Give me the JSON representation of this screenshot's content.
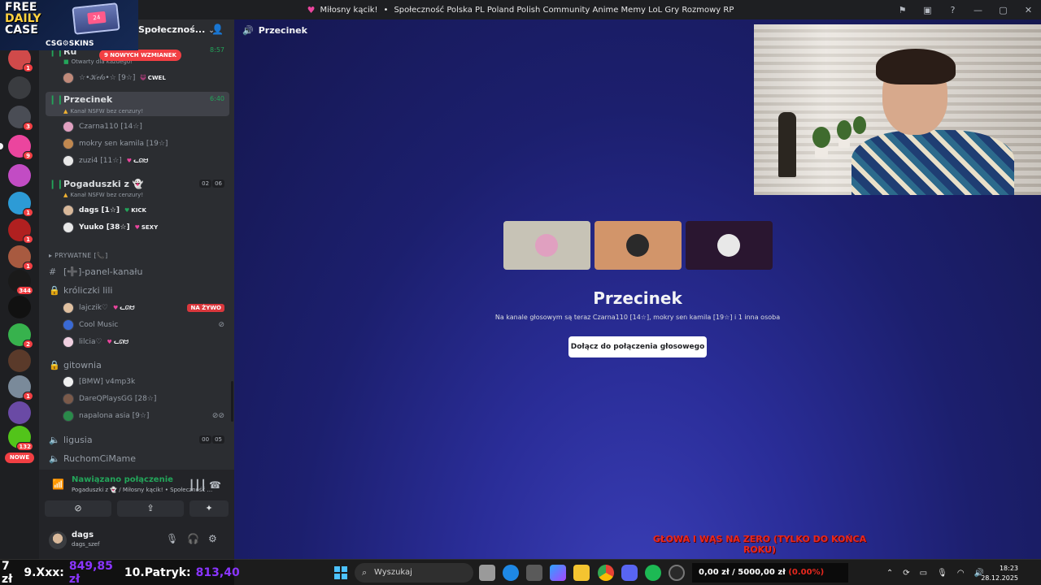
{
  "titlebar": {
    "server_name": "Miłosny kącik!",
    "separator": "•",
    "description": "Społeczność Polska PL Poland Polish Community Anime Memy LoL Gry Rozmowy RP"
  },
  "promo": {
    "line1": "FREE",
    "line2": "DAILY",
    "line3": "CASE",
    "case_label": "24",
    "brand": "CSG⚙SKINS"
  },
  "rail": {
    "servers": [
      {
        "name": "server-1",
        "badge": "1",
        "color": "#d04a4a"
      },
      {
        "name": "server-2",
        "badge": "",
        "color": "#3a3c40"
      },
      {
        "name": "server-3",
        "badge": "3",
        "color": "#4a4d55"
      },
      {
        "name": "server-4",
        "badge": "9",
        "color": "#eb459e"
      },
      {
        "name": "server-5",
        "badge": "",
        "color": "#c24cc4"
      },
      {
        "name": "server-6",
        "badge": "1",
        "color": "#2d9bd6"
      },
      {
        "name": "server-7",
        "badge": "1",
        "color": "#b02020"
      },
      {
        "name": "server-8",
        "badge": "1",
        "color": "#a85a40"
      },
      {
        "name": "server-9",
        "badge": "344",
        "color": "#1a1a1a"
      },
      {
        "name": "server-10",
        "badge": "",
        "color": "#111111"
      },
      {
        "name": "server-11",
        "badge": "2",
        "color": "#37b24d"
      },
      {
        "name": "server-12",
        "badge": "",
        "color": "#5a3a2a"
      },
      {
        "name": "server-13",
        "badge": "1",
        "color": "#7a8a9a"
      },
      {
        "name": "server-14",
        "badge": "",
        "color": "#6a4aa5"
      },
      {
        "name": "server-15",
        "badge": "132",
        "color": "#52c41a"
      }
    ],
    "new_label": "NOWE"
  },
  "sidebar": {
    "server_header": "Społecznoś...",
    "mentions_pill": "9 NOWYCH WZMIANEK",
    "top_channel": {
      "name": "Ru",
      "time": "8:57",
      "sub": "Otwarty dla każdego!"
    },
    "top_member": {
      "name": "☆•𝒦𝑒𝓁𝑜•☆ [9☆]",
      "tag": "CWEL"
    },
    "active_channel": {
      "name": "Przecinek",
      "time": "6:40",
      "sub": "Kanał NSFW bez cenzury!"
    },
    "active_members": [
      {
        "name": "Czarna110 [14☆]",
        "tag": "",
        "color": "#e0a0c0"
      },
      {
        "name": "mokry sen kamila [19☆]",
        "tag": "",
        "color": "#c08850"
      },
      {
        "name": "zuzi4 [11☆]",
        "tag": "ᓚᘏᗢ",
        "color": "#e8e8e8"
      }
    ],
    "channel_pogaduszki": {
      "name": "Pogaduszki z 👻",
      "sub": "Kanał NSFW bez cenzury!",
      "ctr_a": "02",
      "ctr_b": "06"
    },
    "pogaduszki_members": [
      {
        "name": "dags [1☆]",
        "tag": "KICK",
        "color": "#d8b89a"
      },
      {
        "name": "Yuuko [38☆]",
        "tag": "SEXY",
        "color": "#e8e8e8"
      }
    ],
    "category_private": "PRYWATNE [📞]",
    "channel_panel": "[➕]-panel-kanału",
    "channel_kroliczki": "króliczki lili",
    "kroliczki_members": [
      {
        "name": "lajczik♡",
        "tag": "ᓚᘏᗢ",
        "live": "NA ŻYWO",
        "color": "#e0c0a0"
      },
      {
        "name": "Cool Music",
        "tag": "",
        "live": "",
        "color": "#3a6ad4"
      },
      {
        "name": "lilcia♡",
        "tag": "ᓚᘏᗢ",
        "live": "",
        "color": "#f0d0e0"
      }
    ],
    "channel_gitownia": "gitownia",
    "gitownia_members": [
      {
        "name": "[BMW] v4mp3k",
        "tag": "",
        "color": "#f0f0f0"
      },
      {
        "name": "DareQPlaysGG [28☆]",
        "tag": "",
        "color": "#7a5a4a"
      },
      {
        "name": "napalona asia [9☆]",
        "tag": "",
        "color": "#2a8a4a"
      }
    ],
    "channel_ligusia": {
      "name": "ligusia",
      "ctr_a": "00",
      "ctr_b": "05"
    },
    "channel_ruchom": "RuchomCiMame"
  },
  "voice_panel": {
    "status": "Nawiązano połączenie",
    "location": "Pogaduszki z 👻 / Miłosny kącik!  •  Społeczność ...",
    "username": "dags",
    "handle": "dags_szef"
  },
  "main": {
    "channel_name": "Przecinek",
    "title": "Przecinek",
    "description": "Na kanale głosowym są teraz Czarna110 [14☆], mokry sen kamila [19☆] i 1 inna osoba",
    "join_button": "Dołącz do połączenia głosowego",
    "tiles": [
      {
        "bg": "#c7c3b6",
        "avatar": "#e0a0c0"
      },
      {
        "bg": "#d2956a",
        "avatar": "#2a2a2a"
      },
      {
        "bg": "#2a1630",
        "avatar": "#e8e8e8"
      }
    ]
  },
  "overlays": {
    "challenge": "GŁOWA I WĄS NA ZERO (TYLKO DO KOŃCA ROKU)"
  },
  "taskbar": {
    "bet_1_rank": "7 zł",
    "bet_2_name": "9.Xxx:",
    "bet_2_amount": "849,85 zł",
    "bet_3_name": "10.Patryk:",
    "bet_3_amount": "813,40",
    "search_placeholder": "Wyszukaj",
    "balance_text": "0,00 zł / 5000,00 zł",
    "balance_pct": "(0.00%)",
    "time": "18:23",
    "date": "28.12.2025"
  }
}
